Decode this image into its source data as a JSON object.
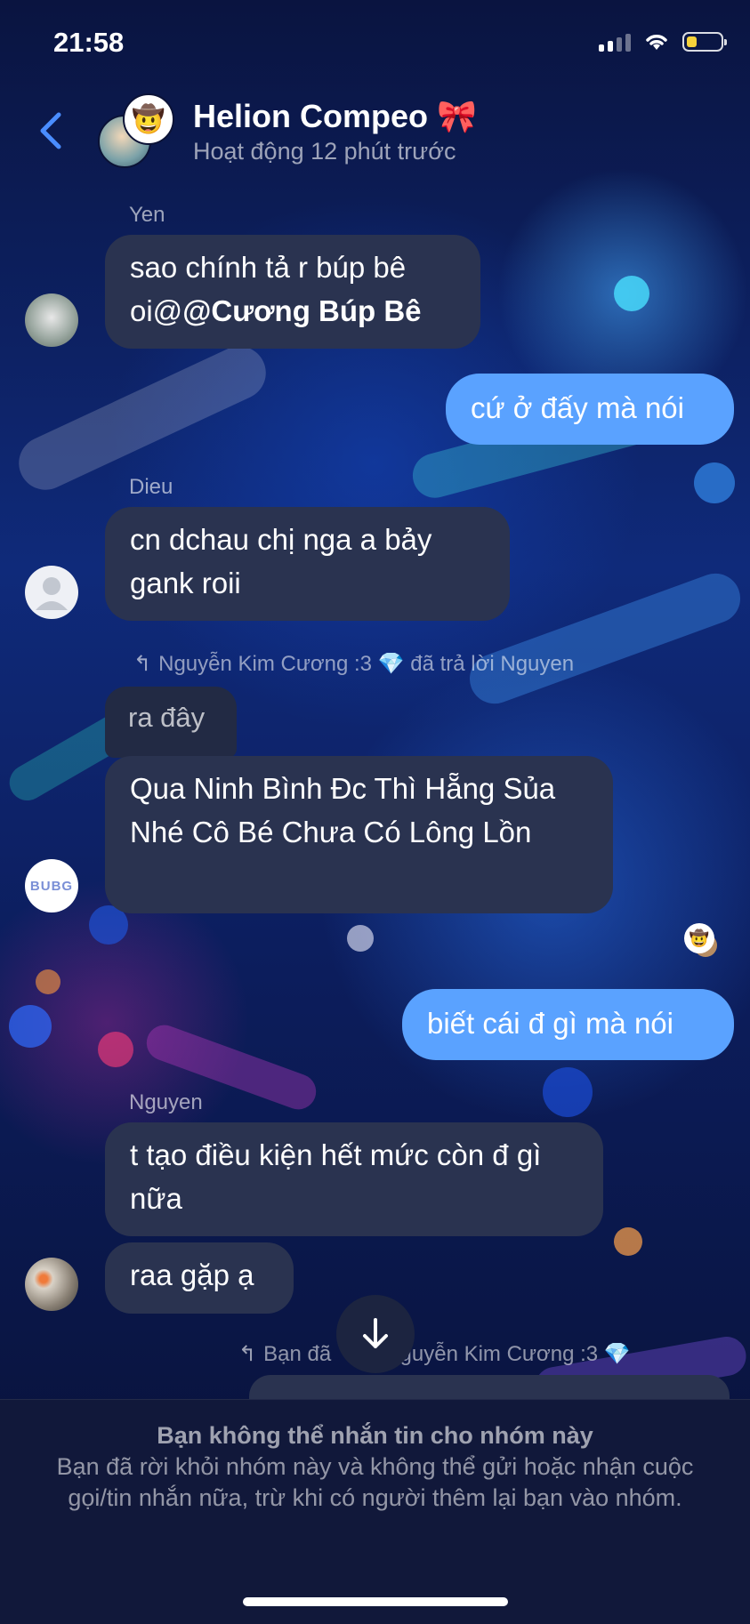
{
  "status_bar": {
    "time": "21:58",
    "battery_level": 0.3,
    "battery_color": "#f6d23a"
  },
  "header": {
    "title": "Helion Compeo 🎀",
    "subtitle": "Hoạt động 12 phút trước",
    "back_icon": "chevron-left-icon"
  },
  "messages": [
    {
      "type": "incoming",
      "sender": "Yen",
      "text_prefix": "sao chính tả r búp bê oi@",
      "mention": "@Cương Búp Bê"
    },
    {
      "type": "outgoing",
      "text": "cứ ở đấy mà nói"
    },
    {
      "type": "incoming",
      "sender": "Dieu",
      "text": "cn dchau chị nga a bảy gank roii"
    },
    {
      "type": "reply",
      "label_name": "Nguyễn Kim Cương :3",
      "label_action": "đã trả lời Nguyen",
      "quoted": "ra đây",
      "text": "Qua Ninh Bình Đc Thì Hẵng Sủa Nhé Cô Bé Chưa Có Lông Lồn"
    },
    {
      "type": "outgoing",
      "text": "biết cái đ gì mà nói"
    },
    {
      "type": "incoming",
      "sender": "Nguyen",
      "text": "t tạo điều kiện hết mức còn đ gì nữa"
    },
    {
      "type": "incoming",
      "text": "raa gặp ạ"
    },
    {
      "type": "reply_label",
      "label_left": "Bạn đã",
      "label_name": "Nguyễn Kim Cương :3"
    }
  ],
  "scroll_down_icon": "arrow-down-icon",
  "notice": {
    "title": "Bạn không thể nhắn tin cho nhóm này",
    "body": "Bạn đã rời khỏi nhóm này và không thể gửi hoặc nhận cuộc gọi/tin nhắn nữa, trừ khi có người thêm lại bạn vào nhóm."
  },
  "colors": {
    "outgoing_bubble": "#5aa2ff",
    "incoming_bubble": "#2a3350",
    "back_chevron": "#4a8dff"
  }
}
